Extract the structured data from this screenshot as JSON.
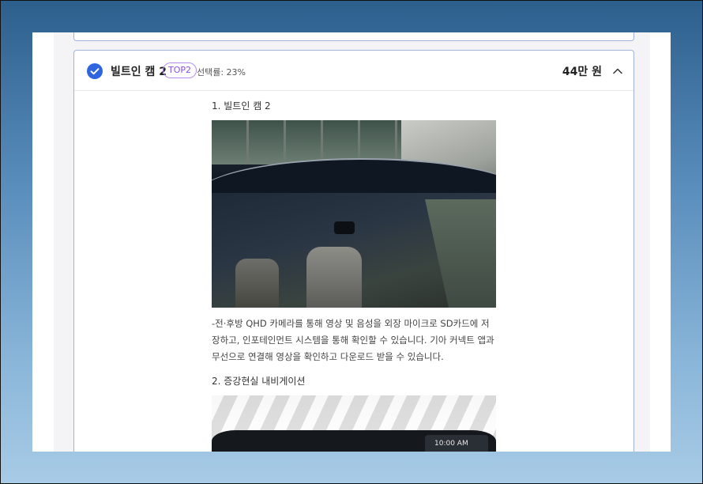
{
  "option": {
    "title": "빌트인 캠 2",
    "rank_badge": "TOP2",
    "select_rate": "선택률: 23%",
    "price": "44만 원"
  },
  "content": {
    "section1_title": "1. 빌트인 캠 2",
    "section1_desc": "-전·후방 QHD 카메라를 통해 영상 및 음성을 외장 마이크로 SD카드에 저장하고, 인포테인먼트 시스템을 통해 확인할 수 있습니다. 기아 커넥트 앱과 무선으로 연결해 영상을 확인하고 다운로드 받을 수 있습니다.",
    "section2_title": "2. 증강현실 내비게이션",
    "photo2_time": "10:00 AM"
  },
  "colors": {
    "check": "#2f66e0",
    "badge": "#8a4fe6",
    "card_border": "#9fb4d6"
  },
  "icons": {
    "selected": "check-icon",
    "collapse": "chevron-up-icon"
  }
}
